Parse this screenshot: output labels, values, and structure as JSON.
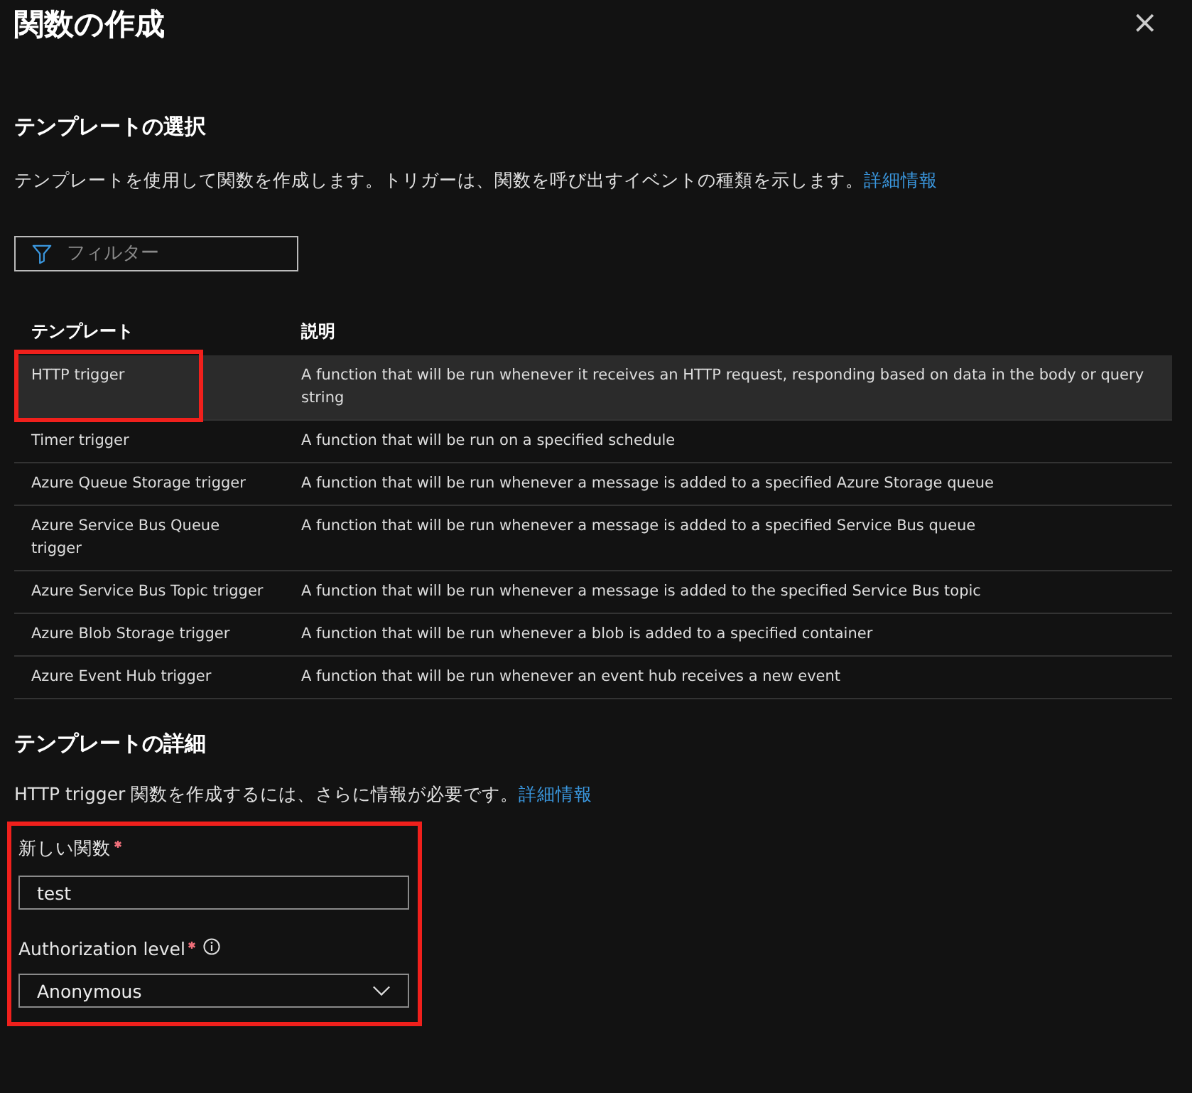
{
  "panel": {
    "title": "関数の作成",
    "close_icon": "×"
  },
  "template_select": {
    "heading": "テンプレートの選択",
    "description": "テンプレートを使用して関数を作成します。トリガーは、関数を呼び出すイベントの種類を示します。",
    "link": "詳細情報"
  },
  "filter": {
    "placeholder": "フィルター"
  },
  "table": {
    "columns": [
      "テンプレート",
      "説明"
    ],
    "rows": [
      {
        "cells": [
          "HTTP trigger",
          "A function that will be run whenever it receives an HTTP request, responding based on data in the body or query string"
        ],
        "selected": true,
        "highlighted": true
      },
      {
        "cells": [
          "Timer trigger",
          "A function that will be run on a specified schedule"
        ],
        "selected": false,
        "highlighted": false
      },
      {
        "cells": [
          "Azure Queue Storage trigger",
          "A function that will be run whenever a message is added to a specified Azure Storage queue"
        ],
        "selected": false,
        "highlighted": false
      },
      {
        "cells": [
          "Azure Service Bus Queue trigger",
          "A function that will be run whenever a message is added to a specified Service Bus queue"
        ],
        "selected": false,
        "highlighted": false
      },
      {
        "cells": [
          "Azure Service Bus Topic trigger",
          "A function that will be run whenever a message is added to the specified Service Bus topic"
        ],
        "selected": false,
        "highlighted": false
      },
      {
        "cells": [
          "Azure Blob Storage trigger",
          "A function that will be run whenever a blob is added to a specified container"
        ],
        "selected": false,
        "highlighted": false
      },
      {
        "cells": [
          "Azure Event Hub trigger",
          "A function that will be run whenever an event hub receives a new event"
        ],
        "selected": false,
        "highlighted": false
      }
    ]
  },
  "template_details": {
    "heading": "テンプレートの詳細",
    "description": "HTTP trigger 関数を作成するには、さらに情報が必要です。",
    "link": "詳細情報"
  },
  "form": {
    "highlighted": true,
    "fields": [
      {
        "kind": "text",
        "label": "新しい関数",
        "required": true,
        "info": false,
        "value": "test"
      },
      {
        "kind": "dropdown",
        "label": "Authorization level",
        "required": true,
        "info": true,
        "value": "Anonymous"
      }
    ]
  }
}
